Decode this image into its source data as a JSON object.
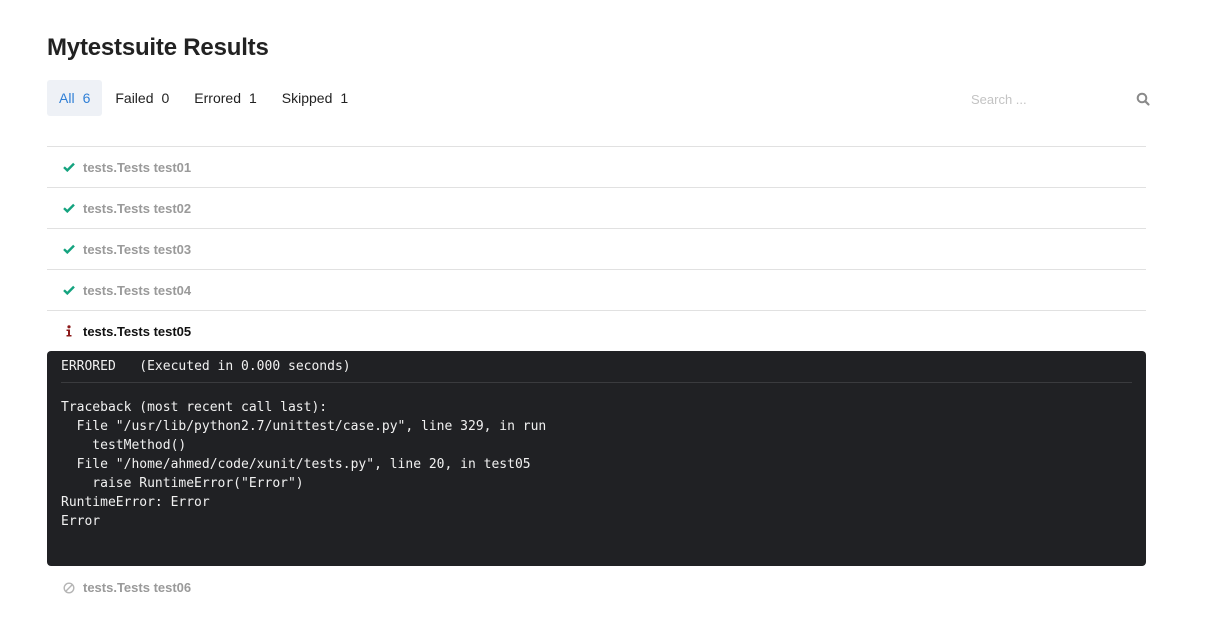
{
  "page": {
    "title": "Mytestsuite Results"
  },
  "tabs": [
    {
      "label": "All",
      "count": "6",
      "active": true
    },
    {
      "label": "Failed",
      "count": "0",
      "active": false
    },
    {
      "label": "Errored",
      "count": "1",
      "active": false
    },
    {
      "label": "Skipped",
      "count": "1",
      "active": false
    }
  ],
  "search": {
    "placeholder": "Search ..."
  },
  "colors": {
    "accent": "#2f7fd6",
    "passed": "#14a37f",
    "errored": "#8b1a1a",
    "skipped": "#b5b5b5",
    "console_bg": "#202124"
  },
  "tests": [
    {
      "name": "tests.Tests test01",
      "status": "passed",
      "icon": "check-icon"
    },
    {
      "name": "tests.Tests test02",
      "status": "passed",
      "icon": "check-icon"
    },
    {
      "name": "tests.Tests test03",
      "status": "passed",
      "icon": "check-icon"
    },
    {
      "name": "tests.Tests test04",
      "status": "passed",
      "icon": "check-icon"
    },
    {
      "name": "tests.Tests test05",
      "status": "errored",
      "icon": "info-icon"
    },
    {
      "name": "tests.Tests test06",
      "status": "skipped",
      "icon": "skip-icon"
    }
  ],
  "detail": {
    "status": "ERRORED",
    "executed": "(Executed in 0.000 seconds)",
    "traceback": "Traceback (most recent call last):\n  File \"/usr/lib/python2.7/unittest/case.py\", line 329, in run\n    testMethod()\n  File \"/home/ahmed/code/xunit/tests.py\", line 20, in test05\n    raise RuntimeError(\"Error\")\nRuntimeError: Error\nError"
  }
}
